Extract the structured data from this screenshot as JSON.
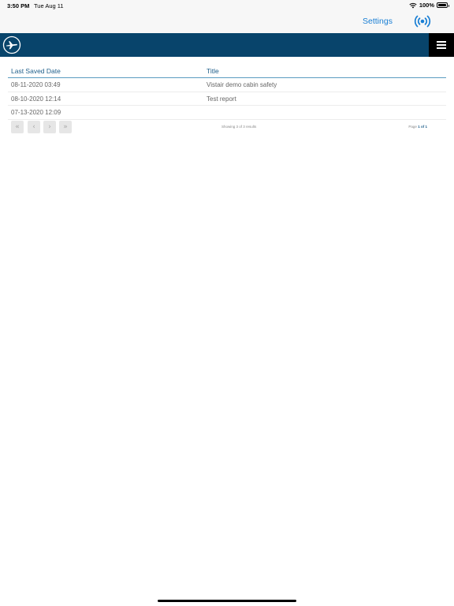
{
  "status_bar": {
    "time": "3:50 PM",
    "date": "Tue Aug 11",
    "battery": "100%"
  },
  "top_bar": {
    "settings_label": "Settings",
    "broadcast_icon": "broadcast-icon"
  },
  "nav": {
    "logo_icon": "airplane-logo-icon",
    "menu_icon": "hamburger-menu-icon"
  },
  "table": {
    "columns": [
      "Last Saved Date",
      "Title"
    ],
    "rows": [
      {
        "date": "08-11-2020 03:49",
        "title": "Vistair demo cabin safety"
      },
      {
        "date": "08-10-2020 12:14",
        "title": "Test report"
      },
      {
        "date": "07-13-2020 12:09",
        "title": ""
      }
    ]
  },
  "pager": {
    "first": "«",
    "prev": "‹",
    "next": "›",
    "last": "»",
    "showing": "Showing 3 of 3 results",
    "page_label": "Page",
    "page_current": "1",
    "page_of": "of",
    "page_total": "1"
  },
  "colors": {
    "nav_bg": "#08446b",
    "accent": "#1a7fd4",
    "header_text": "#1f5f8b"
  }
}
